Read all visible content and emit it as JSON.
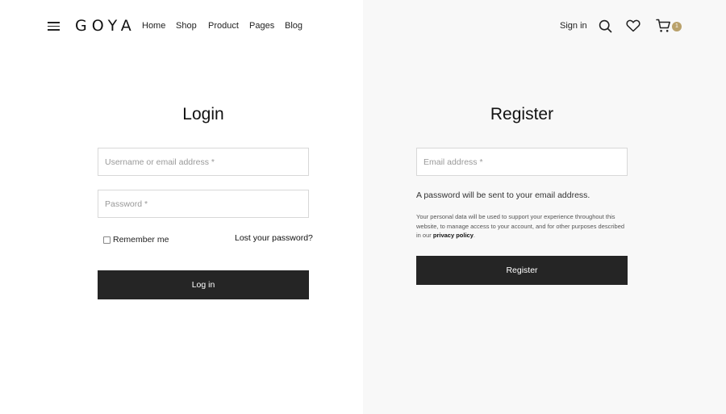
{
  "header": {
    "logo": "GOYA",
    "nav": [
      "Home",
      "Shop",
      "Product",
      "Pages",
      "Blog"
    ],
    "signin": "Sign in",
    "cart_count": "1",
    "icons": {
      "menu": "hamburger-menu-icon",
      "search": "search-icon",
      "wishlist": "heart-icon",
      "cart": "cart-icon"
    },
    "accent_color": "#b9a16b"
  },
  "login": {
    "title": "Login",
    "username_placeholder": "Username or email address *",
    "password_placeholder": "Password *",
    "remember_label": "Remember me",
    "lost_password": "Lost your password?",
    "submit_label": "Log in"
  },
  "register": {
    "title": "Register",
    "email_placeholder": "Email address *",
    "note": "A password will be sent to your email address.",
    "privacy_text": "Your personal data will be used to support your experience throughout this website, to manage access to your account, and for other purposes described in our",
    "privacy_link": "privacy policy",
    "privacy_end": ".",
    "submit_label": "Register"
  },
  "colors": {
    "button_bg": "#252525",
    "right_panel_bg": "#f8f8f8"
  }
}
